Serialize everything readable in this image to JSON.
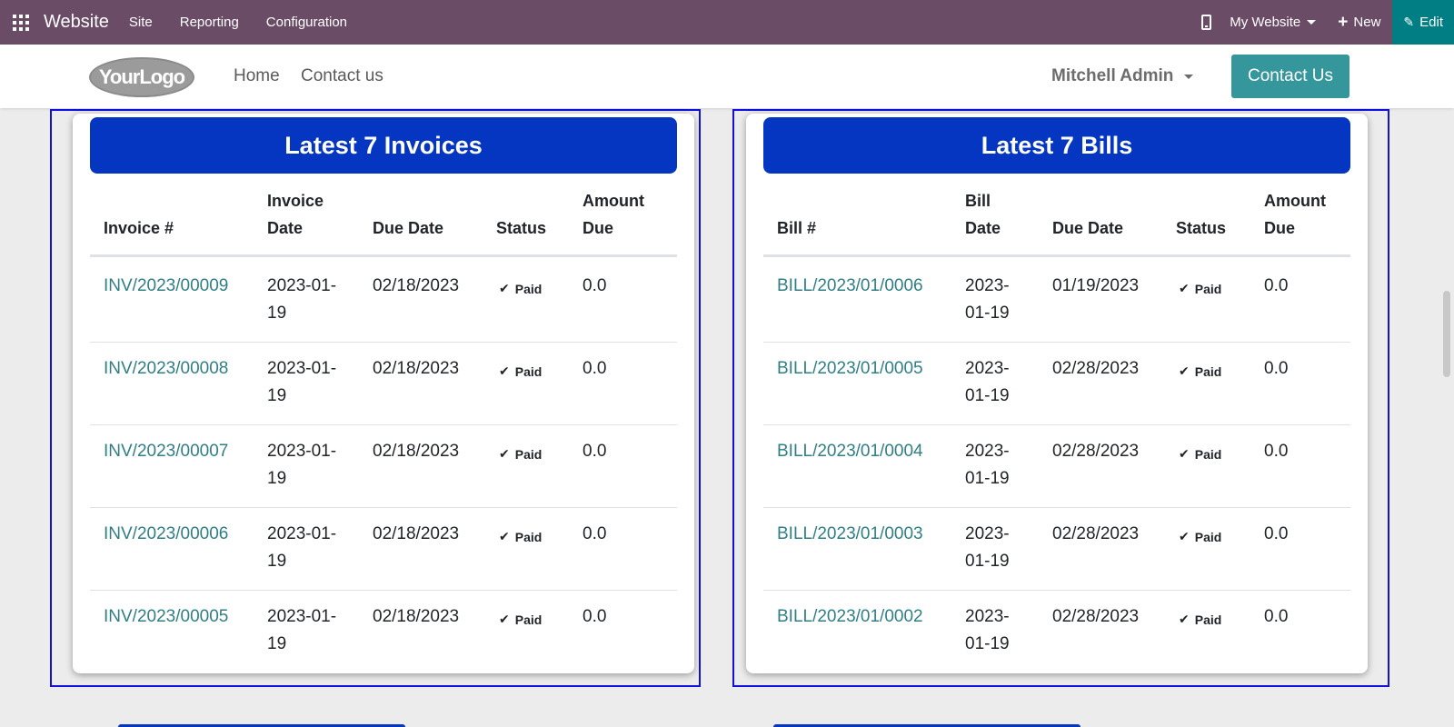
{
  "topbar": {
    "brand": "Website",
    "menus": [
      "Site",
      "Reporting",
      "Configuration"
    ],
    "my_website": "My Website",
    "new_label": "New",
    "edit_label": "Edit"
  },
  "header": {
    "logo_text": "YourLogo",
    "nav": [
      "Home",
      "Contact us"
    ],
    "user": "Mitchell Admin",
    "contact_button": "Contact Us"
  },
  "invoices": {
    "title": "Latest 7 Invoices",
    "columns": {
      "number": "Invoice #",
      "date_line1": "Invoice",
      "date_line2": "Date",
      "due": "Due Date",
      "status": "Status",
      "amount_line1": "Amount",
      "amount_line2": "Due"
    },
    "rows": [
      {
        "number": "INV/2023/00009",
        "date_a": "2023-01-",
        "date_b": "19",
        "due": "02/18/2023",
        "status": "Paid",
        "amount": "0.0"
      },
      {
        "number": "INV/2023/00008",
        "date_a": "2023-01-",
        "date_b": "19",
        "due": "02/18/2023",
        "status": "Paid",
        "amount": "0.0"
      },
      {
        "number": "INV/2023/00007",
        "date_a": "2023-01-",
        "date_b": "19",
        "due": "02/18/2023",
        "status": "Paid",
        "amount": "0.0"
      },
      {
        "number": "INV/2023/00006",
        "date_a": "2023-01-",
        "date_b": "19",
        "due": "02/18/2023",
        "status": "Paid",
        "amount": "0.0"
      },
      {
        "number": "INV/2023/00005",
        "date_a": "2023-01-",
        "date_b": "19",
        "due": "02/18/2023",
        "status": "Paid",
        "amount": "0.0"
      }
    ]
  },
  "bills": {
    "title": "Latest 7 Bills",
    "columns": {
      "number": "Bill #",
      "date_line1": "Bill",
      "date_line2": "Date",
      "due": "Due Date",
      "status": "Status",
      "amount_line1": "Amount",
      "amount_line2": "Due"
    },
    "rows": [
      {
        "number": "BILL/2023/01/0006",
        "date_a": "2023-",
        "date_b": "01-19",
        "due": "01/19/2023",
        "status": "Paid",
        "amount": "0.0"
      },
      {
        "number": "BILL/2023/01/0005",
        "date_a": "2023-",
        "date_b": "01-19",
        "due": "02/28/2023",
        "status": "Paid",
        "amount": "0.0"
      },
      {
        "number": "BILL/2023/01/0004",
        "date_a": "2023-",
        "date_b": "01-19",
        "due": "02/28/2023",
        "status": "Paid",
        "amount": "0.0"
      },
      {
        "number": "BILL/2023/01/0003",
        "date_a": "2023-",
        "date_b": "01-19",
        "due": "02/28/2023",
        "status": "Paid",
        "amount": "0.0"
      },
      {
        "number": "BILL/2023/01/0002",
        "date_a": "2023-",
        "date_b": "01-19",
        "due": "02/28/2023",
        "status": "Paid",
        "amount": "0.0"
      }
    ]
  },
  "colors": {
    "topbar": "#6a4c66",
    "edit": "#017e84",
    "title_bar": "#0536c2",
    "link": "#2f7f84",
    "contact_button": "#35979c"
  }
}
